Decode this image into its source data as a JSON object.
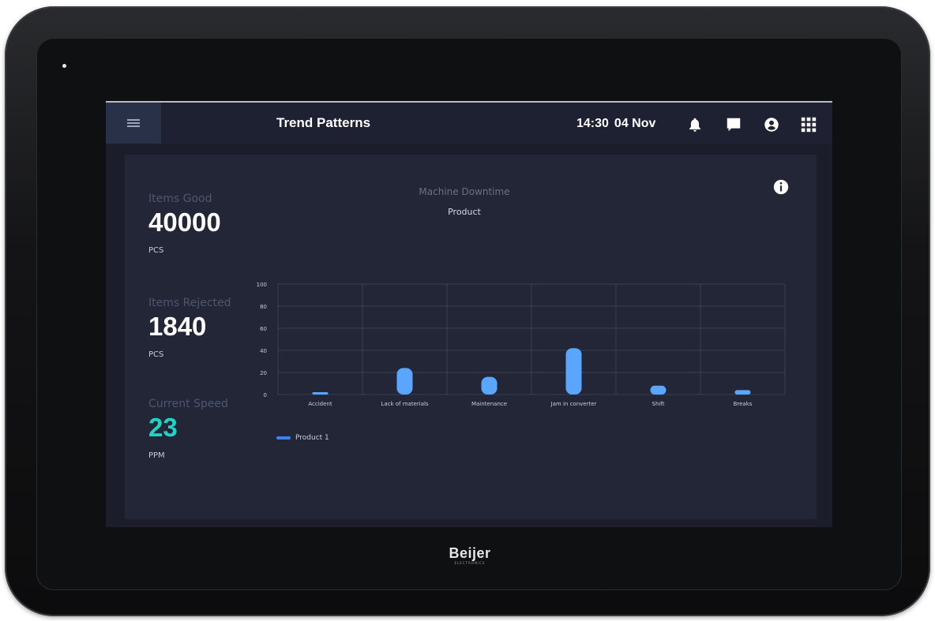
{
  "device": {
    "brand": "Beijer",
    "brand_sub": "ELECTRONICS"
  },
  "topbar": {
    "title": "Trend Patterns",
    "time": "14:30",
    "date": "04 Nov",
    "icons": [
      "hamburger-menu-icon",
      "bell-icon",
      "message-icon",
      "user-icon",
      "apps-grid-icon"
    ]
  },
  "kpis": [
    {
      "label": "Items Good",
      "value": "40000",
      "unit": "PCS",
      "color": "#ffffff"
    },
    {
      "label": "Items Rejected",
      "value": "1840",
      "unit": "PCS",
      "color": "#ffffff"
    },
    {
      "label": "Current Speed",
      "value": "23",
      "unit": "PPM",
      "color": "#22d3c5"
    }
  ],
  "chart_data": {
    "type": "bar",
    "title": "Machine Downtime",
    "subtitle": "Product",
    "categories": [
      "Accident",
      "Lack of materials",
      "Maintenance",
      "Jam in converter",
      "Shift",
      "Breaks"
    ],
    "series": [
      {
        "name": "Product 1",
        "values": [
          2,
          24,
          16,
          42,
          8,
          4
        ],
        "color": "#5aa6ff"
      }
    ],
    "ylim": [
      0,
      100
    ],
    "yticks": [
      0,
      20,
      40,
      60,
      80,
      100
    ],
    "grid": true,
    "legend_position": "bottom-left"
  },
  "colors": {
    "screen_bg": "#1b1d2b",
    "panel_bg": "#222636",
    "accent": "#22d3c5",
    "bar": "#5aa6ff"
  }
}
